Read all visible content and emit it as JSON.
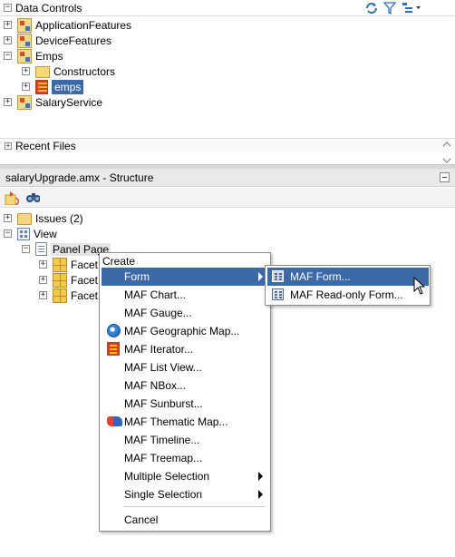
{
  "data_controls": {
    "title": "Data Controls",
    "items": [
      {
        "label": "ApplicationFeatures",
        "expanded": false
      },
      {
        "label": "DeviceFeatures",
        "expanded": false
      },
      {
        "label": "Emps",
        "expanded": true,
        "children": [
          {
            "label": "Constructors",
            "icon": "folder-icon"
          },
          {
            "label": "emps",
            "icon": "collection-icon",
            "selected": true
          }
        ]
      },
      {
        "label": "SalaryService",
        "expanded": false
      }
    ],
    "recent_files": "Recent Files"
  },
  "structure": {
    "title": "salaryUpgrade.amx - Structure",
    "tree": {
      "issues": "Issues (2)",
      "view": "View",
      "panel_page": "Panel Page",
      "facets": [
        "Facet",
        "Facet",
        "Facet"
      ]
    }
  },
  "context_menu": {
    "caption": "Create",
    "items": [
      {
        "label": "Form",
        "has_submenu": true,
        "highlighted": true
      },
      {
        "label": "MAF Chart..."
      },
      {
        "label": "MAF Gauge..."
      },
      {
        "label": "MAF Geographic Map...",
        "icon": "globe-icon"
      },
      {
        "label": "MAF Iterator...",
        "icon": "iterator-icon"
      },
      {
        "label": "MAF List View..."
      },
      {
        "label": "MAF NBox..."
      },
      {
        "label": "MAF Sunburst..."
      },
      {
        "label": "MAF Thematic Map...",
        "icon": "thematic-map-icon"
      },
      {
        "label": "MAF Timeline..."
      },
      {
        "label": "MAF Treemap..."
      },
      {
        "label": "Multiple Selection",
        "has_submenu": true
      },
      {
        "label": "Single Selection",
        "has_submenu": true
      }
    ],
    "cancel": "Cancel"
  },
  "submenu": {
    "items": [
      {
        "label": "MAF Form...",
        "icon": "form-icon",
        "highlighted": true
      },
      {
        "label": "MAF Read-only Form...",
        "icon": "form-icon"
      }
    ]
  },
  "colors": {
    "selection": "#3c6aa8",
    "panel_bg": "#ffffff",
    "chrome_bg": "#ececec"
  }
}
